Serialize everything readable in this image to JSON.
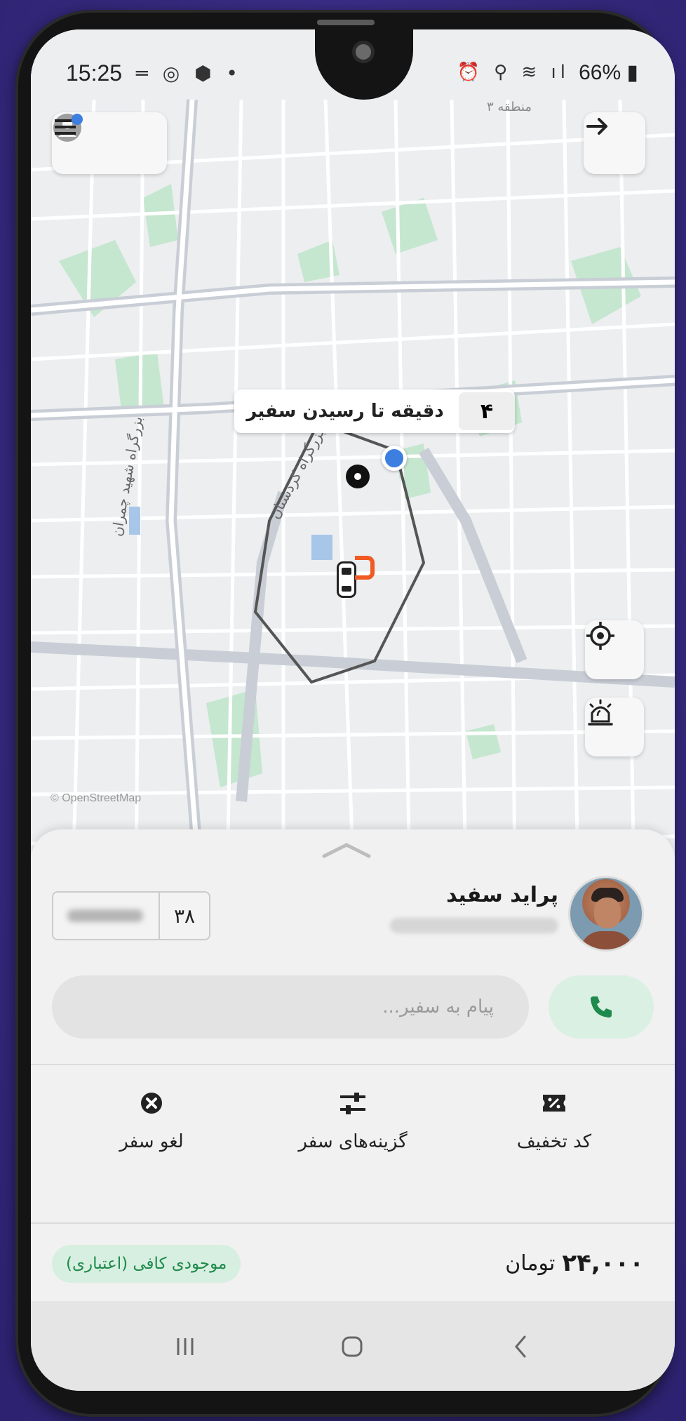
{
  "status_bar": {
    "time": "15:25",
    "battery": "66%"
  },
  "map": {
    "eta_minutes": "۴",
    "eta_text": "دقیقه تا رسیدن سفیر",
    "road_label_1": "بزرگراه شهید چمران",
    "road_label_2": "بزرگراه کردستان",
    "area_label": "منطقه ۳",
    "attribution": "© OpenStreetMap"
  },
  "driver": {
    "car_name": "پراید سفید",
    "plate_code": "۳۸"
  },
  "message": {
    "placeholder": "پیام به سفیر..."
  },
  "actions": [
    {
      "label": "کد تخفیف",
      "icon": "discount-ticket-icon"
    },
    {
      "label": "گزینه‌های سفر",
      "icon": "sliders-icon"
    },
    {
      "label": "لغو سفر",
      "icon": "cancel-circle-icon"
    }
  ],
  "trip": {
    "price_amount": "۲۴,۰۰۰",
    "price_unit": "تومان",
    "balance_badge": "موجودی کافی (اعتباری)"
  },
  "colors": {
    "brand_orange": "#f15a22",
    "accent_green": "#1e8a4c",
    "call_bg": "#daf0e3",
    "marker_blue": "#3d7fe0"
  }
}
